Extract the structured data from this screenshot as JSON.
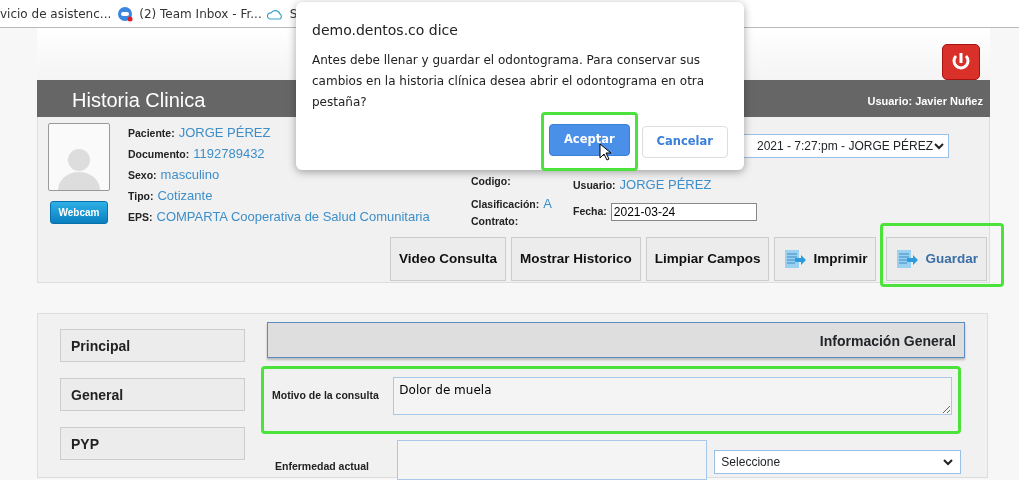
{
  "bookmarks": [
    {
      "label": "vicio de asistenc...",
      "kind": "plain"
    },
    {
      "label": "(2) Team Inbox - Fr...",
      "kind": "chat"
    },
    {
      "label": "S",
      "kind": "cloud"
    }
  ],
  "dialog": {
    "title": "demo.dentos.co dice",
    "message": "Antes debe llenar y guardar el odontograma. Para conservar sus cambios en la historia clínica desea abrir el odontograma en otra pestaña?",
    "buttons": [
      {
        "label": "Aceptar",
        "primary": true,
        "highlighted": true
      },
      {
        "label": "Cancelar",
        "primary": false,
        "highlighted": false
      }
    ]
  },
  "header": {
    "title": "Historia Clinica",
    "user": "Usuario: Javier Nuñez"
  },
  "patient": {
    "webcam_button": "Webcam",
    "fields": [
      {
        "label": "Paciente:",
        "value": "JORGE PÉREZ"
      },
      {
        "label": "Documento:",
        "value": "1192789432"
      },
      {
        "label": "Sexo:",
        "value": "masculino"
      },
      {
        "label": "Tipo:",
        "value": "Cotizante"
      },
      {
        "label": "EPS:",
        "value": "COMPARTA Cooperativa de Salud Comunitaria"
      }
    ]
  },
  "record": {
    "fields": [
      {
        "label": "Codigo:"
      },
      {
        "label": "Clasificación:",
        "value": "A"
      },
      {
        "label": "Contrato:"
      }
    ],
    "history_select": "2021 - 7:27:pm - JORGE PÉREZ",
    "user_label": "Usuario:",
    "user_value": "JORGE PÉREZ",
    "date_label": "Fecha:",
    "date_value": "2021-03-24"
  },
  "actions": [
    {
      "label": "Video Consulta",
      "kind": "text",
      "highlighted": false
    },
    {
      "label": "Mostrar Historico",
      "kind": "text",
      "highlighted": false
    },
    {
      "label": "Limpiar Campos",
      "kind": "text",
      "highlighted": false
    },
    {
      "label": "Imprimir",
      "kind": "icon",
      "highlighted": false
    },
    {
      "label": "Guardar",
      "kind": "icon",
      "highlighted": true
    }
  ],
  "sidebar": {
    "items": [
      "Principal",
      "General",
      "PYP"
    ]
  },
  "section": {
    "title": "Información General",
    "rows": [
      {
        "label": "Motivo de la consulta",
        "value": "Dolor de muela",
        "highlighted": true,
        "kind": "textarea"
      },
      {
        "label": "Enfermedad actual",
        "kind": "input-select",
        "select": "Seleccione",
        "highlighted": false
      }
    ]
  }
}
